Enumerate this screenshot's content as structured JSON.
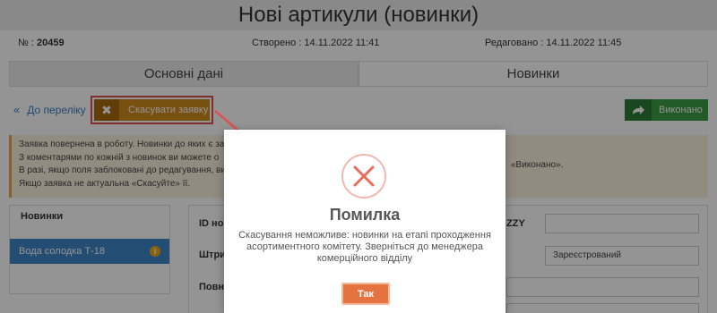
{
  "page_title": "Нові артикули (новинки)",
  "meta": {
    "number_label": "№ :",
    "number_value": "20459",
    "created": "Створено : 14.11.2022 11:41",
    "edited": "Редаговано : 14.11.2022 11:45"
  },
  "tabs": [
    {
      "label": "Основні дані",
      "active": false
    },
    {
      "label": "Новинки",
      "active": true
    }
  ],
  "toolbar": {
    "back_label": "До переліку",
    "cancel_label": "Скасувати заявку",
    "done_label": "Виконано"
  },
  "alert": {
    "line1": "Заявка повернена в роботу. Новинки до яких є за",
    "line2": "З коментарями по кожній з новинок ви можете о",
    "line3": "В разі, якщо поля заблоковані до редагування, ви",
    "line4": "Якщо заявка не актуальна «Скасуйте» її.",
    "line2_tail": "«Виконано»."
  },
  "panel": {
    "heading": "Новинки",
    "item_label": "Вода солодка Т-18",
    "item_badge": "i"
  },
  "form": {
    "id_label": "ID нов",
    "barcode_label": "Штри",
    "fullname_label": "Повна",
    "right_label": "ZZY",
    "status_value": "Зареєстрований"
  },
  "modal": {
    "title": "Помилка",
    "message": "Скасування неможливе: новинки на етапі проходження асортиментного комітету. Зверніться до менеджера комерційного відділу",
    "ok_label": "Так"
  },
  "colors": {
    "cancel_button": "#cf8c1e",
    "done_button": "#3c9b45",
    "ok_button": "#e5733f",
    "annotation": "#e0504f",
    "selected_item": "#3d85c6"
  },
  "icons": {
    "back": "double-chevron-left-icon",
    "cancel": "close-icon",
    "done": "forward-arrow-icon",
    "error": "error-x-circle-icon",
    "info": "info-icon"
  }
}
